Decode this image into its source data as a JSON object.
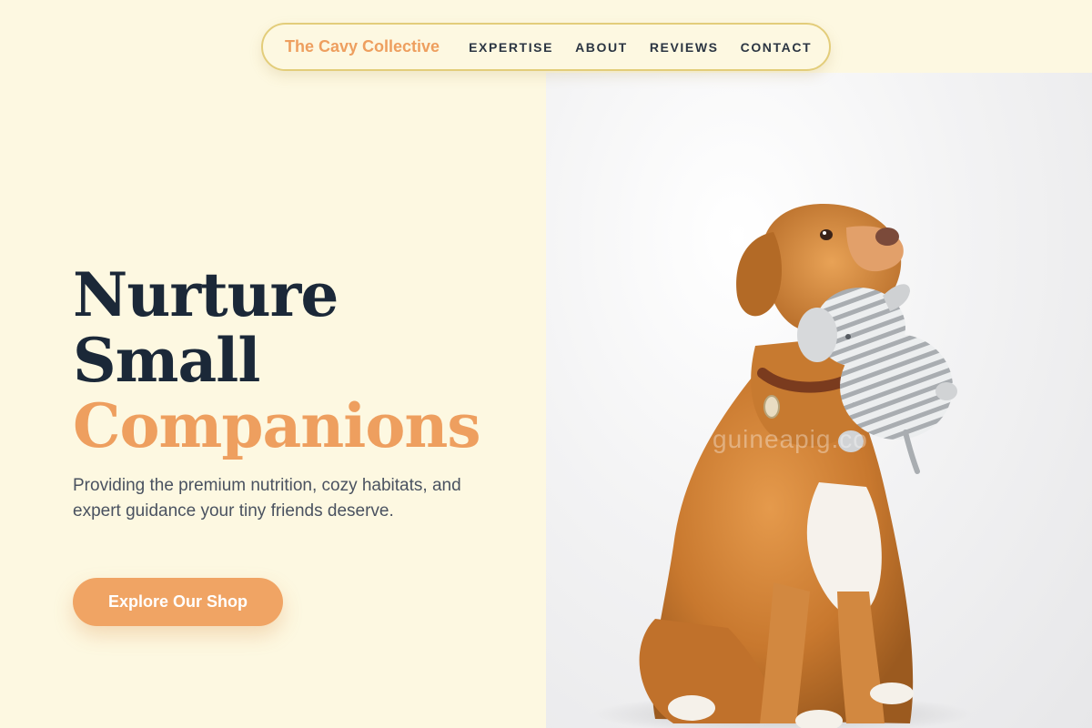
{
  "nav": {
    "brand": "The Cavy Collective",
    "links": [
      {
        "label": "EXPERTISE"
      },
      {
        "label": "ABOUT"
      },
      {
        "label": "REVIEWS"
      },
      {
        "label": "CONTACT"
      }
    ]
  },
  "hero": {
    "headline_line1": "Nurture",
    "headline_line2": "Small",
    "headline_line3": "Companions",
    "subtitle": "Providing the premium nutrition, cozy habitats, and expert guidance your tiny friends deserve.",
    "cta_label": "Explore Our Shop"
  },
  "photo": {
    "watermark": "guineapig.co",
    "subject": "dog holding striped plush elephant toy"
  },
  "colors": {
    "background": "#fdf8e1",
    "accent": "#ee9f5f",
    "heading": "#1b2838",
    "nav_border": "#e3cd7a"
  }
}
